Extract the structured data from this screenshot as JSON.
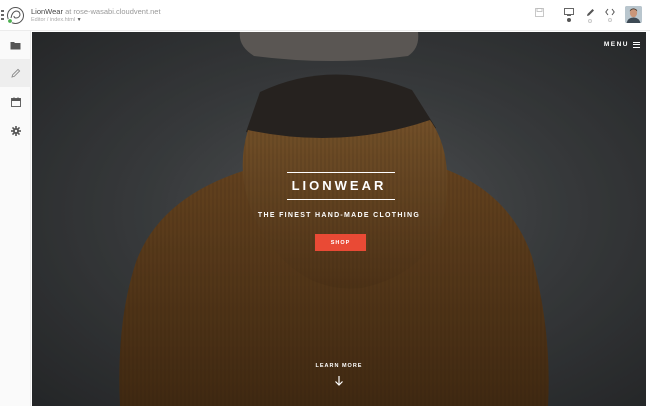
{
  "header": {
    "site_name": "LionWear",
    "at_text": "at",
    "host": "rose-wasabi.cloudvent.net",
    "breadcrumb": "Editor / index.html"
  },
  "toolbar": {
    "icons": [
      "save-icon",
      "desktop-preview-icon",
      "pencil-icon",
      "code-icon"
    ]
  },
  "sidebar": {
    "items": [
      {
        "icon": "folder-icon"
      },
      {
        "icon": "pencil-icon"
      },
      {
        "icon": "calendar-icon"
      },
      {
        "icon": "gear-icon"
      }
    ]
  },
  "hero": {
    "menu_label": "MENU",
    "brand": "LIONWEAR",
    "tagline": "THE FINEST HAND-MADE CLOTHING",
    "shop_label": "SHOP",
    "learn_more": "LEARN MORE"
  },
  "colors": {
    "accent": "#e94a35",
    "status_dot": "#4caf50"
  }
}
